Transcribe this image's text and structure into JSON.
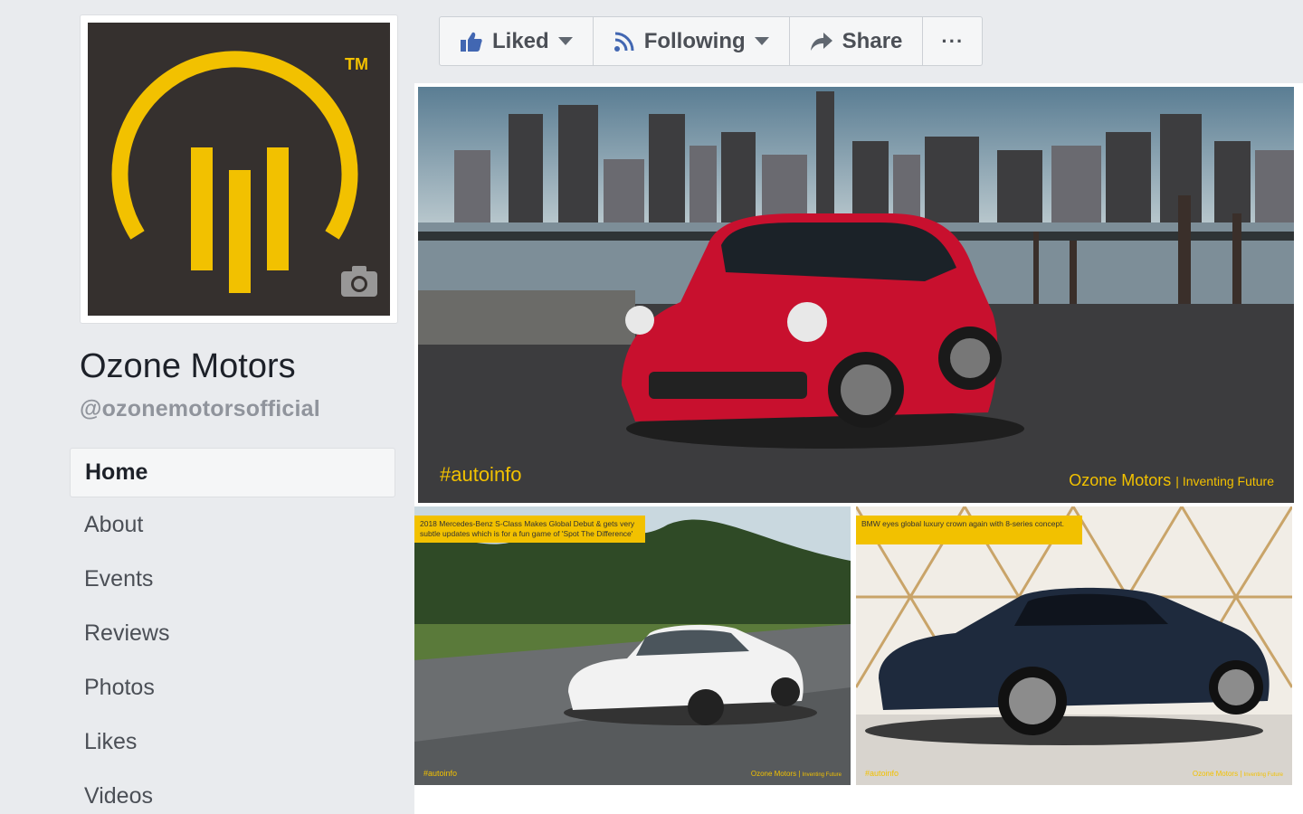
{
  "page": {
    "name": "Ozone Motors",
    "handle": "@ozonemotorsofficial"
  },
  "logo": {
    "trademark": "TM",
    "bg_color": "#35302e",
    "accent_color": "#f2c100"
  },
  "nav": {
    "items": [
      {
        "label": "Home",
        "active": true
      },
      {
        "label": "About"
      },
      {
        "label": "Events"
      },
      {
        "label": "Reviews"
      },
      {
        "label": "Photos"
      },
      {
        "label": "Likes"
      },
      {
        "label": "Videos"
      }
    ]
  },
  "actions": {
    "liked": "Liked",
    "following": "Following",
    "share": "Share",
    "more": "···"
  },
  "posts": {
    "hero": {
      "hashtag": "#autoinfo",
      "brand": "Ozone Motors",
      "tagline": "Inventing Future"
    },
    "left": {
      "note": "2018 Mercedes-Benz S-Class Makes Global Debut & gets very subtle updates which is for a fun game of 'Spot The Difference'",
      "hashtag": "#autoinfo",
      "brand": "Ozone Motors",
      "tagline": "Inventing Future"
    },
    "right": {
      "note": "BMW eyes global luxury crown again with 8-series concept.",
      "hashtag": "#autoinfo",
      "brand": "Ozone Motors",
      "tagline": "Inventing Future"
    }
  }
}
